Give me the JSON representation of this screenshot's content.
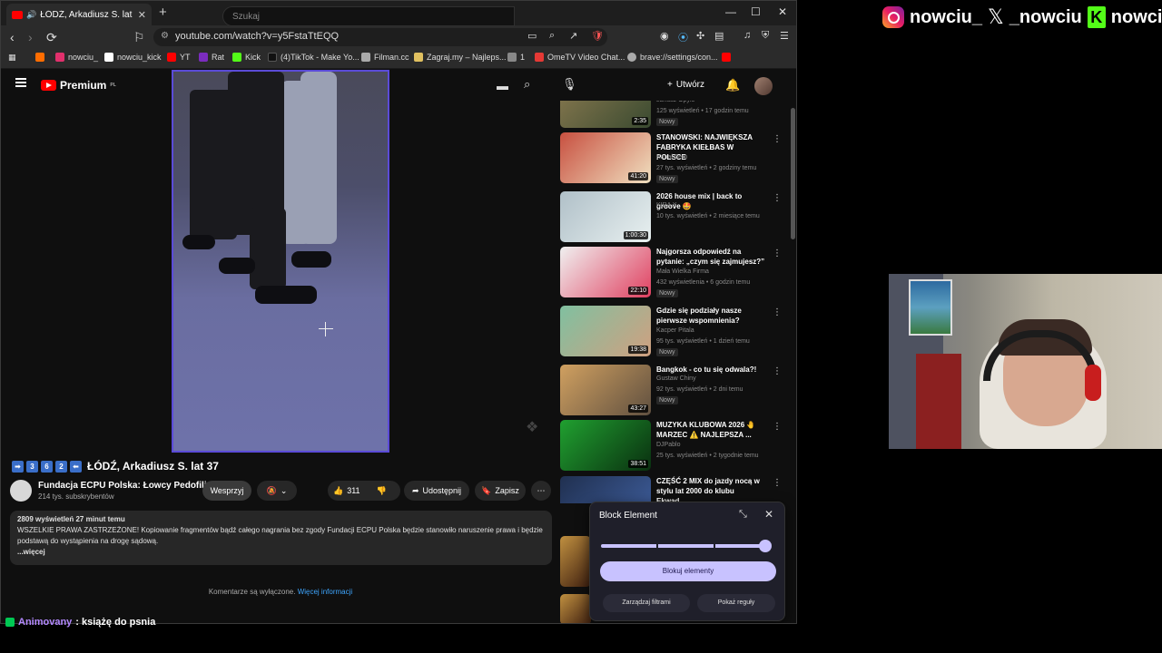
{
  "browser": {
    "tab_title": "ŁÓDŹ, Arkadiusz S. lat 37",
    "tab_prefix": "🔊 ➡3️⃣6️⃣2️⃣",
    "url": "youtube.com/watch?v=y5FstaTtEQQ",
    "bookmarks": [
      "nowciu_",
      "nowciu_kick",
      "YT",
      "Rat",
      "Kick",
      "(4)TikTok - Make Yo...",
      "Filman.cc",
      "Zagraj.my – Najleps...",
      "1",
      "OmeTV Video Chat...",
      "brave://settings/con..."
    ],
    "bookmark_colors": [
      "#ff6d00",
      "#e1306c",
      "#ffffff",
      "#f00",
      "#7b2cbf",
      "#53fc18",
      "#111",
      "#aaa",
      "#e0c060",
      "#888",
      "#e53935",
      "#aaa",
      "#f00"
    ]
  },
  "yt": {
    "logo_text": "Premium",
    "logo_sup": "PL",
    "search_placeholder": "Szukaj",
    "create_label": "Utwórz"
  },
  "video": {
    "title": "ŁÓDŹ, Arkadiusz S. lat 37",
    "title_emojis": [
      "➡",
      "3",
      "6",
      "2",
      "⬅"
    ],
    "channel_name": "Fundacja ECPU Polska: Łowcy Pedofili",
    "subscribers": "214 tys. subskrybentów",
    "support_label": "Wesprzyj",
    "likes": "311",
    "share_label": "Udostępnij",
    "save_label": "Zapisz",
    "views_time": "2809 wyświetleń  27 minut temu",
    "description": "WSZELKIE PRAWA ZASTRZEŻONE! Kopiowanie fragmentów bądź całego nagrania bez zgody Fundacji ECPU Polska będzie stanowiło naruszenie prawa i będzie podstawą do wystąpienia na drogę sądową.",
    "more_label": "...więcej",
    "comments_off": "Komentarze są wyłączone.",
    "comments_link": "Więcej informacji"
  },
  "recommendations": [
    {
      "title": "",
      "channel": "Janusz Opyio",
      "meta": "125 wyświetleń • 17 godzin temu",
      "badge": "Nowy",
      "duration": "2:35",
      "c1": "#8a7a50",
      "c2": "#3a4a30"
    },
    {
      "title": "STANOWSKI: NAJWIĘKSZA FABRYKA KIEŁBAS W POLSCE",
      "channel": "Kanał Zero",
      "meta": "27 tys. wyświetleń • 2 godziny temu",
      "badge": "Nowy",
      "duration": "41:20",
      "c1": "#c85040",
      "c2": "#f0e0c0"
    },
    {
      "title": "2026 house mix | back to groove 🤩",
      "channel": "KIRA X",
      "meta": "10 tys. wyświetleń • 2 miesiące temu",
      "badge": "",
      "duration": "1:00:30",
      "c1": "#b0c0c8",
      "c2": "#e8f0f0"
    },
    {
      "title": "Najgorsza odpowiedź na pytanie: „czym się zajmujesz?”",
      "channel": "Mała Wielka Firma",
      "meta": "432 wyświetlenia • 6 godzin temu",
      "badge": "Nowy",
      "duration": "22:10",
      "c1": "#f0f0f0",
      "c2": "#e04060"
    },
    {
      "title": "Gdzie się podziały nasze pierwsze wspomnienia?",
      "channel": "Kacper Pitala",
      "meta": "95 tys. wyświetleń • 1 dzień temu",
      "badge": "Nowy",
      "duration": "19:38",
      "c1": "#80c0a0",
      "c2": "#d0a080"
    },
    {
      "title": "Bangkok - co tu się odwala?!",
      "channel": "Gustaw Chiny",
      "meta": "92 tys. wyświetleń • 2 dni temu",
      "badge": "Nowy",
      "duration": "43:27",
      "c1": "#d0a060",
      "c2": "#605040"
    },
    {
      "title": "MUZYKA KLUBOWA 2026 🤚 MARZEC ⚠️ NAJLEPSZA ...",
      "channel": "DJPablo",
      "meta": "25 tys. wyświetleń • 2 tygodnie temu",
      "badge": "",
      "duration": "38:51",
      "c1": "#20a030",
      "c2": "#0a3010"
    },
    {
      "title": "CZĘŚĆ 2 MIX do jazdy nocą w stylu lat 2000 do klubu Ekwad...",
      "channel": "",
      "meta": "",
      "badge": "",
      "duration": "",
      "c1": "#203050",
      "c2": "#4060a0"
    }
  ],
  "block_element": {
    "title": "Block Element",
    "primary_label": "Blokuj elementy",
    "manage_label": "Zarządzaj filtrami",
    "rules_label": "Pokaż reguły",
    "slider_level": 1.0
  },
  "overlay": {
    "instagram": "nowciu_",
    "x": "_nowciu",
    "kick": "nowciu",
    "x_glyph": "𝕏",
    "kick_glyph": "K"
  },
  "chat": {
    "user": "Animovany",
    "message": ": książę do psnia"
  }
}
